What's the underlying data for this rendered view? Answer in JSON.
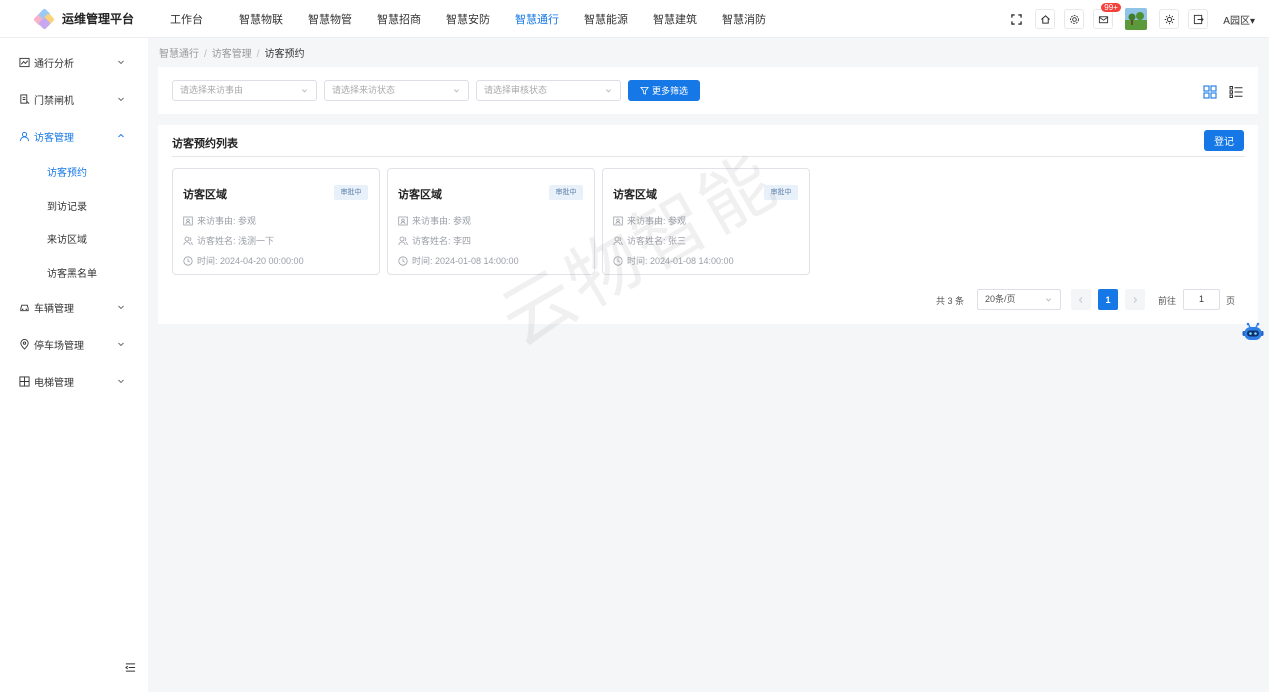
{
  "header": {
    "title": "运维管理平台",
    "nav": [
      {
        "label": "工作台",
        "active": false
      },
      {
        "label": "智慧物联",
        "active": false
      },
      {
        "label": "智慧物管",
        "active": false
      },
      {
        "label": "智慧招商",
        "active": false
      },
      {
        "label": "智慧安防",
        "active": false
      },
      {
        "label": "智慧通行",
        "active": true
      },
      {
        "label": "智慧能源",
        "active": false
      },
      {
        "label": "智慧建筑",
        "active": false
      },
      {
        "label": "智慧消防",
        "active": false
      }
    ],
    "mail_badge": "99+",
    "park_select": "A园区▾",
    "icons": [
      "fullscreen-icon",
      "home-icon",
      "settings-icon",
      "mail-icon",
      "avatar",
      "theme-icon",
      "logout-icon"
    ]
  },
  "sidebar": {
    "items": [
      {
        "label": "通行分析",
        "icon": "chart-icon"
      },
      {
        "label": "门禁闸机",
        "icon": "gate-icon"
      },
      {
        "label": "访客管理",
        "icon": "visitor-icon",
        "open": true
      },
      {
        "label": "车辆管理",
        "icon": "car-icon"
      },
      {
        "label": "停车场管理",
        "icon": "location-icon"
      },
      {
        "label": "电梯管理",
        "icon": "elevator-icon"
      }
    ],
    "sub_items": [
      {
        "label": "访客预约",
        "active": true
      },
      {
        "label": "到访记录",
        "active": false
      },
      {
        "label": "来访区域",
        "active": false
      },
      {
        "label": "访客黑名单",
        "active": false
      }
    ]
  },
  "breadcrumb": [
    "智慧通行",
    "访客管理",
    "访客预约"
  ],
  "filters": {
    "reason_placeholder": "请选择来访事由",
    "visit_status_placeholder": "请选择来访状态",
    "audit_status_placeholder": "请选择审核状态",
    "more_label": "更多筛选"
  },
  "list": {
    "title": "访客预约列表",
    "register_label": "登记",
    "cards": [
      {
        "title": "访客区域",
        "status": "审批中",
        "reason": "来访事由: 参观",
        "name": "访客姓名: 浅测一下",
        "time": "时间: 2024-04-20 00:00:00"
      },
      {
        "title": "访客区域",
        "status": "审批中",
        "reason": "来访事由: 参观",
        "name": "访客姓名: 李四",
        "time": "时间: 2024-01-08 14:00:00"
      },
      {
        "title": "访客区域",
        "status": "审批中",
        "reason": "来访事由: 参观",
        "name": "访客姓名: 张三",
        "time": "时间: 2024-01-08 14:00:00"
      }
    ]
  },
  "pagination": {
    "total": "共 3 条",
    "page_size": "20条/页",
    "current_page": "1",
    "goto_label": "前往",
    "goto_value": "1",
    "page_suffix": "页"
  },
  "watermark": "云物智能",
  "colors": {
    "primary": "#1677e6",
    "badge": "#f5413b",
    "background": "#f5f6f8"
  }
}
